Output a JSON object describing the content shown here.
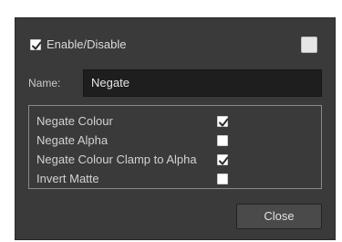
{
  "dialog": {
    "enable_label": "Enable/Disable",
    "enable_checked": true,
    "name_label": "Name:",
    "name_value": "Negate",
    "options": [
      {
        "label": "Negate Colour",
        "checked": true
      },
      {
        "label": "Negate Alpha",
        "checked": false
      },
      {
        "label": "Negate Colour Clamp to Alpha",
        "checked": true
      },
      {
        "label": "Invert Matte",
        "checked": false
      }
    ],
    "close_label": "Close"
  },
  "icons": {
    "checkmark": "checkmark-icon"
  }
}
